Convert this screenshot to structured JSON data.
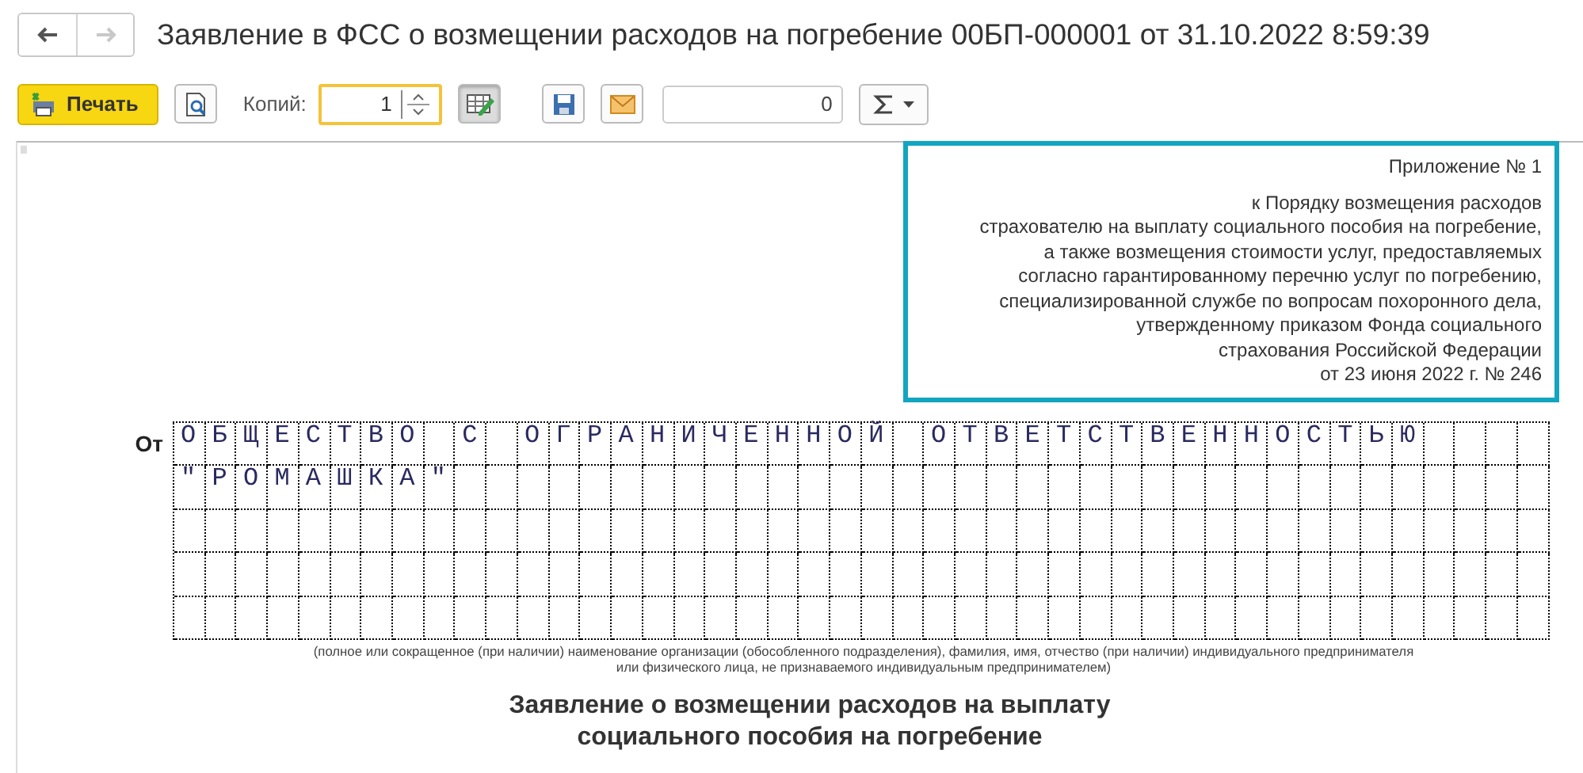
{
  "window": {
    "title": "Заявление в ФСС о возмещении расходов на погребение 00БП-000001 от 31.10.2022 8:59:39"
  },
  "nav": [
    {
      "kind": "back",
      "disabled": false
    },
    {
      "kind": "forward",
      "disabled": true
    }
  ],
  "toolbar": {
    "print_label": "Печать",
    "copies_label": "Копий:",
    "copies_value": "1",
    "edit_pressed": true,
    "sum_value": "0"
  },
  "document": {
    "appendix": [
      "Приложение № 1",
      "к Порядку возмещения расходов",
      "страхователю на выплату социального пособия на погребение,",
      "а также возмещения стоимости услуг, предоставляемых",
      "согласно гарантированному перечню услуг по погребению,",
      "специализированной службе по вопросам похоронного дела,",
      "утвержденному приказом Фонда социального",
      "страхования Российской Федерации",
      "от 23 июня 2022 г. № 246"
    ],
    "from_label": "От",
    "grid_rows": [
      "ОБЩЕСТВО С ОГРАНИЧЕННОЙ ОТВЕТСТВЕННОСТЬЮ",
      "\"РОМАШКА\""
    ],
    "caption": [
      "(полное или сокращенное (при наличии) наименование организации (обособленного подразделения), фамилия, имя, отчество (при наличии) индивидуального предпринимателя",
      "или физического лица, не признаваемого индивидуальным предпринимателем)"
    ],
    "heading": [
      "Заявление о возмещении расходов на выплату",
      "социального пособия на погребение"
    ]
  }
}
